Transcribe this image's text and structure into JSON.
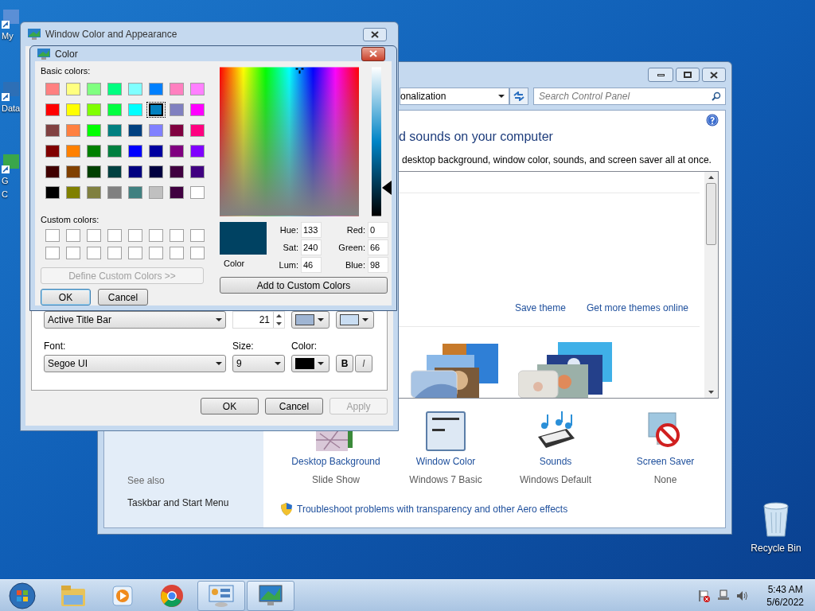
{
  "desktop_icons": [
    {
      "lines": [
        "My"
      ]
    },
    {
      "lines": [
        "Data"
      ]
    },
    {
      "lines": [
        "G",
        "C"
      ]
    }
  ],
  "recycle_bin": {
    "label": "Recycle Bin"
  },
  "control_panel": {
    "address": "onalization",
    "search_placeholder": "Search Control Panel",
    "heading": "d sounds on your computer",
    "subtitle": "desktop background, window color, sounds, and screen saver all at once.",
    "theme_links": [
      "Save theme",
      "Get more themes online"
    ],
    "settings": [
      {
        "kind": "background",
        "title": "Desktop Background",
        "value": "Slide Show"
      },
      {
        "kind": "window",
        "title": "Window Color",
        "value": "Windows 7 Basic"
      },
      {
        "kind": "sounds",
        "title": "Sounds",
        "value": "Windows Default"
      },
      {
        "kind": "screensaver",
        "title": "Screen Saver",
        "value": "None"
      }
    ],
    "troubleshoot": "Troubleshoot problems with transparency and other Aero effects",
    "see_also": {
      "heading": "See also",
      "links": [
        "Taskbar and Start Menu"
      ]
    }
  },
  "appearance_dialog": {
    "title": "Window Color and Appearance",
    "item": "Active Title Bar",
    "item_size": "21",
    "item_swatches": [
      {
        "color": "#9fb5d3"
      },
      {
        "color": "#c9ddf2"
      }
    ],
    "font_label": "Font:",
    "font": "Segoe UI",
    "size_label": "Size:",
    "size": "9",
    "color_label": "Color:",
    "font_swatch": {
      "color": "#000000"
    },
    "bold": "B",
    "italic": "I",
    "buttons": [
      {
        "label": "OK",
        "disabled": false
      },
      {
        "label": "Cancel",
        "disabled": false
      },
      {
        "label": "Apply",
        "disabled": true
      }
    ]
  },
  "color_dialog": {
    "title": "Color",
    "basic_label": "Basic colors:",
    "basic_colors": [
      {
        "color": "#ff8080",
        "selected": false
      },
      {
        "color": "#ffff80",
        "selected": false
      },
      {
        "color": "#80ff80",
        "selected": false
      },
      {
        "color": "#00ff80",
        "selected": false
      },
      {
        "color": "#80ffff",
        "selected": false
      },
      {
        "color": "#0080ff",
        "selected": false
      },
      {
        "color": "#ff80c0",
        "selected": false
      },
      {
        "color": "#ff80ff",
        "selected": false
      },
      {
        "color": "#ff0000",
        "selected": false
      },
      {
        "color": "#ffff00",
        "selected": false
      },
      {
        "color": "#80ff00",
        "selected": false
      },
      {
        "color": "#00ff40",
        "selected": false
      },
      {
        "color": "#00ffff",
        "selected": false
      },
      {
        "color": "#0080c0",
        "selected": true
      },
      {
        "color": "#8080c0",
        "selected": false
      },
      {
        "color": "#ff00ff",
        "selected": false
      },
      {
        "color": "#804040",
        "selected": false
      },
      {
        "color": "#ff8040",
        "selected": false
      },
      {
        "color": "#00ff00",
        "selected": false
      },
      {
        "color": "#008080",
        "selected": false
      },
      {
        "color": "#004080",
        "selected": false
      },
      {
        "color": "#8080ff",
        "selected": false
      },
      {
        "color": "#800040",
        "selected": false
      },
      {
        "color": "#ff0080",
        "selected": false
      },
      {
        "color": "#800000",
        "selected": false
      },
      {
        "color": "#ff8000",
        "selected": false
      },
      {
        "color": "#008000",
        "selected": false
      },
      {
        "color": "#008040",
        "selected": false
      },
      {
        "color": "#0000ff",
        "selected": false
      },
      {
        "color": "#0000a0",
        "selected": false
      },
      {
        "color": "#800080",
        "selected": false
      },
      {
        "color": "#8000ff",
        "selected": false
      },
      {
        "color": "#400000",
        "selected": false
      },
      {
        "color": "#804000",
        "selected": false
      },
      {
        "color": "#004000",
        "selected": false
      },
      {
        "color": "#004040",
        "selected": false
      },
      {
        "color": "#000080",
        "selected": false
      },
      {
        "color": "#000040",
        "selected": false
      },
      {
        "color": "#400040",
        "selected": false
      },
      {
        "color": "#400080",
        "selected": false
      },
      {
        "color": "#000000",
        "selected": false
      },
      {
        "color": "#808000",
        "selected": false
      },
      {
        "color": "#808040",
        "selected": false
      },
      {
        "color": "#808080",
        "selected": false
      },
      {
        "color": "#408080",
        "selected": false
      },
      {
        "color": "#c0c0c0",
        "selected": false
      },
      {
        "color": "#400040",
        "selected": false
      },
      {
        "color": "#ffffff",
        "selected": false
      }
    ],
    "custom_label": "Custom colors:",
    "define_button": {
      "label": "Define Custom Colors >>",
      "disabled": true
    },
    "buttons": [
      {
        "label": "OK",
        "default": true
      },
      {
        "label": "Cancel",
        "default": false
      }
    ],
    "preview": {
      "color": "#004262",
      "label": "Color"
    },
    "fields_left": [
      {
        "label": "Hue:",
        "value": "133"
      },
      {
        "label": "Sat:",
        "value": "240"
      },
      {
        "label": "Lum:",
        "value": "46"
      }
    ],
    "fields_right": [
      {
        "label": "Red:",
        "value": "0"
      },
      {
        "label": "Green:",
        "value": "66"
      },
      {
        "label": "Blue:",
        "value": "98"
      }
    ],
    "add_button": "Add to Custom Colors"
  },
  "taskbar": {
    "apps": [
      {
        "kind": "folder",
        "active": false
      },
      {
        "kind": "media",
        "active": false
      },
      {
        "kind": "browser",
        "active": false
      },
      {
        "kind": "control",
        "active": true
      },
      {
        "kind": "display",
        "active": true
      }
    ],
    "time": "5:43 AM",
    "date": "5/6/2022"
  }
}
